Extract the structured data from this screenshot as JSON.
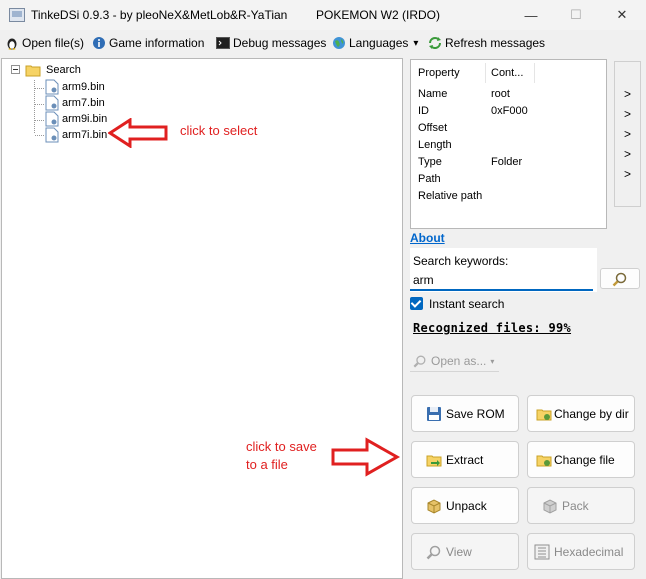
{
  "window": {
    "title": "TinkeDSi 0.9.3 - by pleoNeX&MetLob&R-YaTian",
    "game_title": "POKEMON W2 (IRDO)",
    "min_glyph": "—",
    "max_glyph": "☐",
    "close_glyph": "✕"
  },
  "menubar": {
    "items": [
      {
        "label": "Open file(s)",
        "icon": "linux-penguin-icon"
      },
      {
        "label": "Game information",
        "icon": "info-icon"
      },
      {
        "label": "Debug messages",
        "icon": "console-icon"
      },
      {
        "label": "Languages",
        "icon": "globe-icon"
      },
      {
        "label": "Refresh messages",
        "icon": "refresh-icon"
      }
    ],
    "dropdown_glyph": "▾"
  },
  "tree": {
    "root": {
      "label": "Search",
      "expander": "collapse"
    },
    "children": [
      {
        "label": "arm9.bin"
      },
      {
        "label": "arm7.bin"
      },
      {
        "label": "arm9i.bin"
      },
      {
        "label": "arm7i.bin"
      }
    ]
  },
  "properties": {
    "headers": [
      "Property",
      "Cont..."
    ],
    "rows": [
      {
        "key": "Name",
        "value": "root"
      },
      {
        "key": "ID",
        "value": "0xF000"
      },
      {
        "key": "Offset",
        "value": ""
      },
      {
        "key": "Length",
        "value": ""
      },
      {
        "key": "Type",
        "value": "Folder"
      },
      {
        "key": "Path",
        "value": ""
      },
      {
        "key": "Relative path",
        "value": ""
      }
    ],
    "arrow_glyph": ">"
  },
  "about_link": "About",
  "search": {
    "label": "Search keywords:",
    "value": "arm",
    "instant_label": "Instant search",
    "instant_checked": true
  },
  "recognized": "Recognized files: 99%",
  "open_as": "Open as...",
  "buttons": {
    "save_rom": "Save ROM",
    "change_by_dir": "Change by dir",
    "extract": "Extract",
    "change_file": "Change file",
    "unpack": "Unpack",
    "pack": "Pack",
    "view": "View",
    "hexadecimal": "Hexadecimal"
  },
  "annotations": {
    "select": "click to select",
    "save_line1": "click to save",
    "save_line2": "to a file"
  },
  "colors": {
    "accent": "#0067c0",
    "annotation_red": "#e02020"
  }
}
